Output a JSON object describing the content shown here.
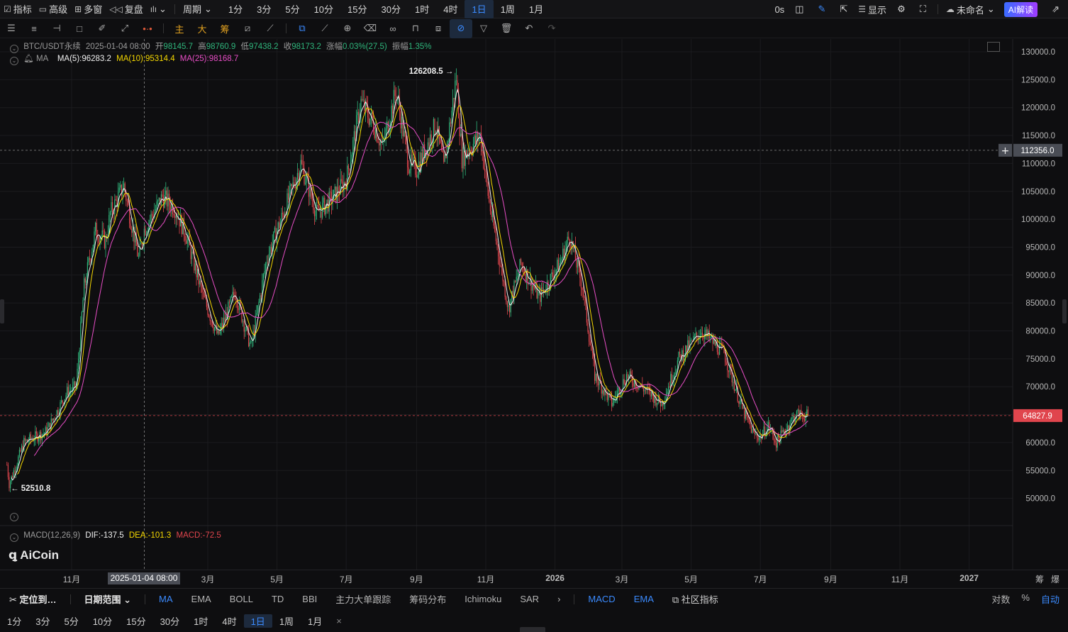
{
  "topbar": {
    "indicators": "指标",
    "advanced": "高级",
    "multiwin": "多窗",
    "replay": "复盘",
    "period": "周期",
    "intervals": [
      "1分",
      "3分",
      "5分",
      "10分",
      "15分",
      "30分",
      "1时",
      "4时",
      "1日",
      "1周",
      "1月"
    ],
    "active_interval": "1日",
    "countdown": "0s",
    "display": "显示",
    "layout_name": "未命名",
    "ai": "AI解读"
  },
  "toolbar": {
    "main": "主",
    "big": "大",
    "chips": "筹"
  },
  "legend": {
    "symbol": "BTC/USDT永续",
    "date": "2025-01-04 08:00",
    "open_label": "开",
    "open": "98145.7",
    "high_label": "高",
    "high": "98760.9",
    "low_label": "低",
    "low": "97438.2",
    "close_label": "收",
    "close": "98173.2",
    "change_label": "涨幅",
    "change": "0.03%(27.5)",
    "amp_label": "振幅",
    "amp": "1.35%",
    "ma_name": "MA",
    "ma5": "MA(5):96283.2",
    "ma10": "MA(10):95314.4",
    "ma25": "MA(25):98168.7"
  },
  "macd": {
    "name": "MACD(12,26,9)",
    "dif": "DIF:-137.5",
    "dea": "DEA:-101.3",
    "macd": "MACD:-72.5"
  },
  "watermark": "AiCoin",
  "annotations": {
    "high": "126208.5",
    "low": "52510.8",
    "crosshair_price": "112356.0",
    "last_price": "64827.9"
  },
  "colors": {
    "up": "#2fb67c",
    "down": "#e0454d",
    "ma5": "#f2f2f2",
    "ma10": "#f5d800",
    "ma25": "#e84ec6",
    "accent": "#3b8bff"
  },
  "chart_data": {
    "type": "candlestick",
    "symbol": "BTC/USDT",
    "ylim": [
      48000,
      132000
    ],
    "y_ticks": [
      "130000.0",
      "125000.0",
      "120000.0",
      "115000.0",
      "110000.0",
      "105000.0",
      "100000.0",
      "95000.0",
      "90000.0",
      "85000.0",
      "80000.0",
      "75000.0",
      "70000.0",
      "65000.0",
      "60000.0",
      "55000.0",
      "50000.0"
    ],
    "y_tick_values": [
      130000,
      125000,
      120000,
      115000,
      110000,
      105000,
      100000,
      95000,
      90000,
      85000,
      80000,
      75000,
      70000,
      65000,
      60000,
      55000,
      50000
    ],
    "x_ticks": [
      "11月",
      "3月",
      "5月",
      "7月",
      "9月",
      "11月",
      "2026",
      "3月",
      "5月",
      "7月",
      "9月",
      "11月",
      "2027"
    ],
    "x_tick_dates": [
      "2024-11-01",
      "2025-03-01",
      "2025-05-01",
      "2025-07-01",
      "2025-09-01",
      "2025-11-01",
      "2026-01-01",
      "2026-03-01",
      "2026-05-01",
      "2026-07-01",
      "2026-09-01",
      "2026-11-01",
      "2027-01-01"
    ],
    "selected_x": "2025-01-04 08:00",
    "selected_date": "2025-01-04",
    "start_date": "2024-09-05",
    "end_date": "2026-08-12",
    "close_keypoints": [
      [
        "2024-09-05",
        56000
      ],
      [
        "2024-09-07",
        52600
      ],
      [
        "2024-09-20",
        60000
      ],
      [
        "2024-10-10",
        62000
      ],
      [
        "2024-10-28",
        69000
      ],
      [
        "2024-11-05",
        70000
      ],
      [
        "2024-11-12",
        88000
      ],
      [
        "2024-11-22",
        98000
      ],
      [
        "2024-12-01",
        96000
      ],
      [
        "2024-12-05",
        101000
      ],
      [
        "2024-12-17",
        106000
      ],
      [
        "2024-12-30",
        93000
      ],
      [
        "2025-01-04",
        98200
      ],
      [
        "2025-01-20",
        104000
      ],
      [
        "2025-01-31",
        102000
      ],
      [
        "2025-02-10",
        97000
      ],
      [
        "2025-02-25",
        86000
      ],
      [
        "2025-03-10",
        79000
      ],
      [
        "2025-03-25",
        87000
      ],
      [
        "2025-04-08",
        77000
      ],
      [
        "2025-04-22",
        93000
      ],
      [
        "2025-05-10",
        103000
      ],
      [
        "2025-05-22",
        110000
      ],
      [
        "2025-06-05",
        101000
      ],
      [
        "2025-06-20",
        104000
      ],
      [
        "2025-07-01",
        107000
      ],
      [
        "2025-07-14",
        121000
      ],
      [
        "2025-07-25",
        117000
      ],
      [
        "2025-08-02",
        113000
      ],
      [
        "2025-08-14",
        123000
      ],
      [
        "2025-08-25",
        110000
      ],
      [
        "2025-09-01",
        109000
      ],
      [
        "2025-09-18",
        117000
      ],
      [
        "2025-09-25",
        109000
      ],
      [
        "2025-10-06",
        125500
      ],
      [
        "2025-10-11",
        111000
      ],
      [
        "2025-10-27",
        115000
      ],
      [
        "2025-11-04",
        103000
      ],
      [
        "2025-11-21",
        84000
      ],
      [
        "2025-12-02",
        92000
      ],
      [
        "2025-12-18",
        86000
      ],
      [
        "2026-01-05",
        92000
      ],
      [
        "2026-01-14",
        97000
      ],
      [
        "2026-01-25",
        88000
      ],
      [
        "2026-02-05",
        72000
      ],
      [
        "2026-02-20",
        67000
      ],
      [
        "2026-03-05",
        72000
      ],
      [
        "2026-03-18",
        70000
      ],
      [
        "2026-04-05",
        67000
      ],
      [
        "2026-04-20",
        75000
      ],
      [
        "2026-05-10",
        80000
      ],
      [
        "2026-05-30",
        76000
      ],
      [
        "2026-06-15",
        66000
      ],
      [
        "2026-06-25",
        61500
      ],
      [
        "2026-07-01",
        61000
      ],
      [
        "2026-07-08",
        63000
      ],
      [
        "2026-07-15",
        60000
      ],
      [
        "2026-08-01",
        65000
      ],
      [
        "2026-08-12",
        64828
      ]
    ]
  }
}
